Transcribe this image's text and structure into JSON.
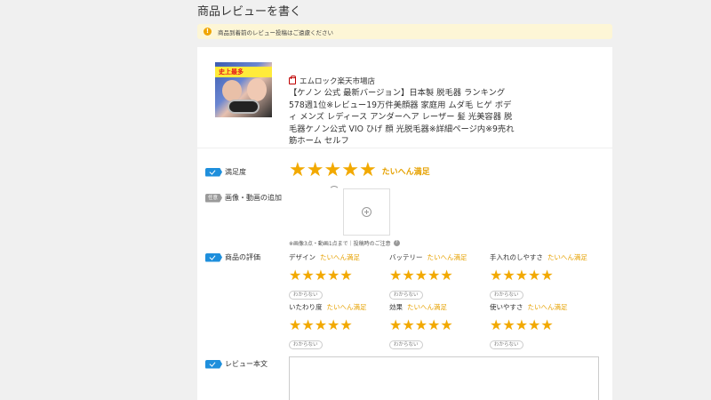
{
  "page": {
    "title": "商品レビューを書く"
  },
  "notice": {
    "icon": "info-icon",
    "text": "商品到着前のレビュー投稿はご遠慮ください"
  },
  "product": {
    "thumbnail_banner": "史上最多",
    "shop_icon": "shop-bag-icon",
    "shop_name": "エムロック楽天市場店",
    "title": "【ケノン 公式 最新バージョン】日本製 脱毛器 ランキング578週1位※レビュー19万件美顔器 家庭用 ムダ毛 ヒゲ ボディ メンズ レディース アンダーヘア レーザー 髪 光美容器 脱毛器ケノン公式 VIO ひげ 顔 光脱毛器※詳細ページ内※9売れ筋ホーム セルフ"
  },
  "satisfaction": {
    "label": "満足度",
    "stars": 5,
    "max": 5,
    "rating_text": "たいへん満足"
  },
  "media": {
    "optional_badge": "任意",
    "label": "画像・動画の追加",
    "note": "※画像3点・動画1点まで｜投稿時のご注意"
  },
  "evaluation": {
    "label": "商品の評価",
    "dont_know_label": "わからない",
    "criteria": [
      {
        "name": "デザイン",
        "rating_text": "たいへん満足",
        "stars": 5
      },
      {
        "name": "バッテリー",
        "rating_text": "たいへん満足",
        "stars": 5
      },
      {
        "name": "手入れのしやすさ",
        "rating_text": "たいへん満足",
        "stars": 5
      },
      {
        "name": "いたわり度",
        "rating_text": "たいへん満足",
        "stars": 5
      },
      {
        "name": "効果",
        "rating_text": "たいへん満足",
        "stars": 5
      },
      {
        "name": "使いやすさ",
        "rating_text": "たいへん満足",
        "stars": 5
      }
    ]
  },
  "review_body": {
    "label": "レビュー本文",
    "value": ""
  },
  "colors": {
    "accent_blue": "#1e8fdc",
    "star": "#f2a900",
    "rating_text": "#e6a100",
    "notice_bg": "#fdf6d6"
  }
}
